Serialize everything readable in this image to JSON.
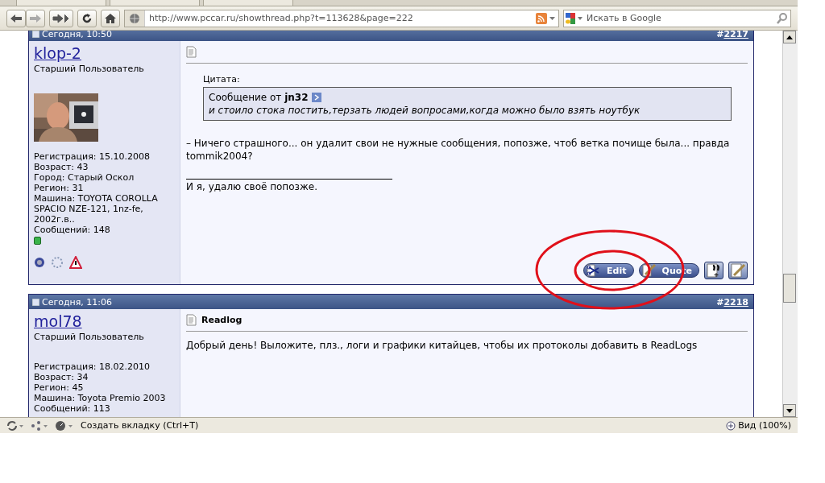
{
  "toolbar": {
    "url": "http://www.pccar.ru/showthread.php?t=113628&page=222",
    "search_placeholder": "Искать в Google"
  },
  "posts": [
    {
      "date": "Сегодня, 10:50",
      "sign": "#",
      "number": "2217",
      "username": "klop-2",
      "rank": "Старший Пользователь",
      "has_avatar": true,
      "info": [
        "Регистрация: 15.10.2008",
        "Возраст: 43",
        "Город: Старый Оскол",
        "Регион: 31",
        "Машина: TOYOTA COROLLA SPACIO NZE-121, 1nz-fe, 2002г.в..",
        "Сообщений: 148"
      ],
      "online": true,
      "quote": {
        "label": "Цитата:",
        "prefix": "Сообщение от",
        "author": "jn32",
        "text": "и стоило стока постить,терзать людей вопросами,когда можно было взять ноутбук"
      },
      "message": "– Ничего страшного... он удалит свои не нужные сообщения, попозже, чтоб ветка почище была... правда tommik2004?",
      "signature": "И я, удалю своё попозже.",
      "buttons": [
        {
          "kind": "edit",
          "label": "Edit"
        },
        {
          "kind": "quote",
          "label": "Quote"
        },
        {
          "kind": "multiquote"
        },
        {
          "kind": "quickreply"
        }
      ]
    },
    {
      "date": "Сегодня, 11:06",
      "sign": "#",
      "number": "2218",
      "username": "mol78",
      "rank": "Старший Пользователь",
      "has_avatar": false,
      "info": [
        "Регистрация: 18.02.2010",
        "Возраст: 34",
        "Регион: 45",
        "Машина: Toyota Premio 2003",
        "Сообщений: 113"
      ],
      "title": "Readlog",
      "message": "Добрый день! Выложите, плз., логи и графики китайцев, чтобы их протоколы добавить в ReadLogs"
    }
  ],
  "status_bar": {
    "new_tab": "Создать вкладку (Ctrl+T)",
    "zoom": "Вид (100%)"
  }
}
